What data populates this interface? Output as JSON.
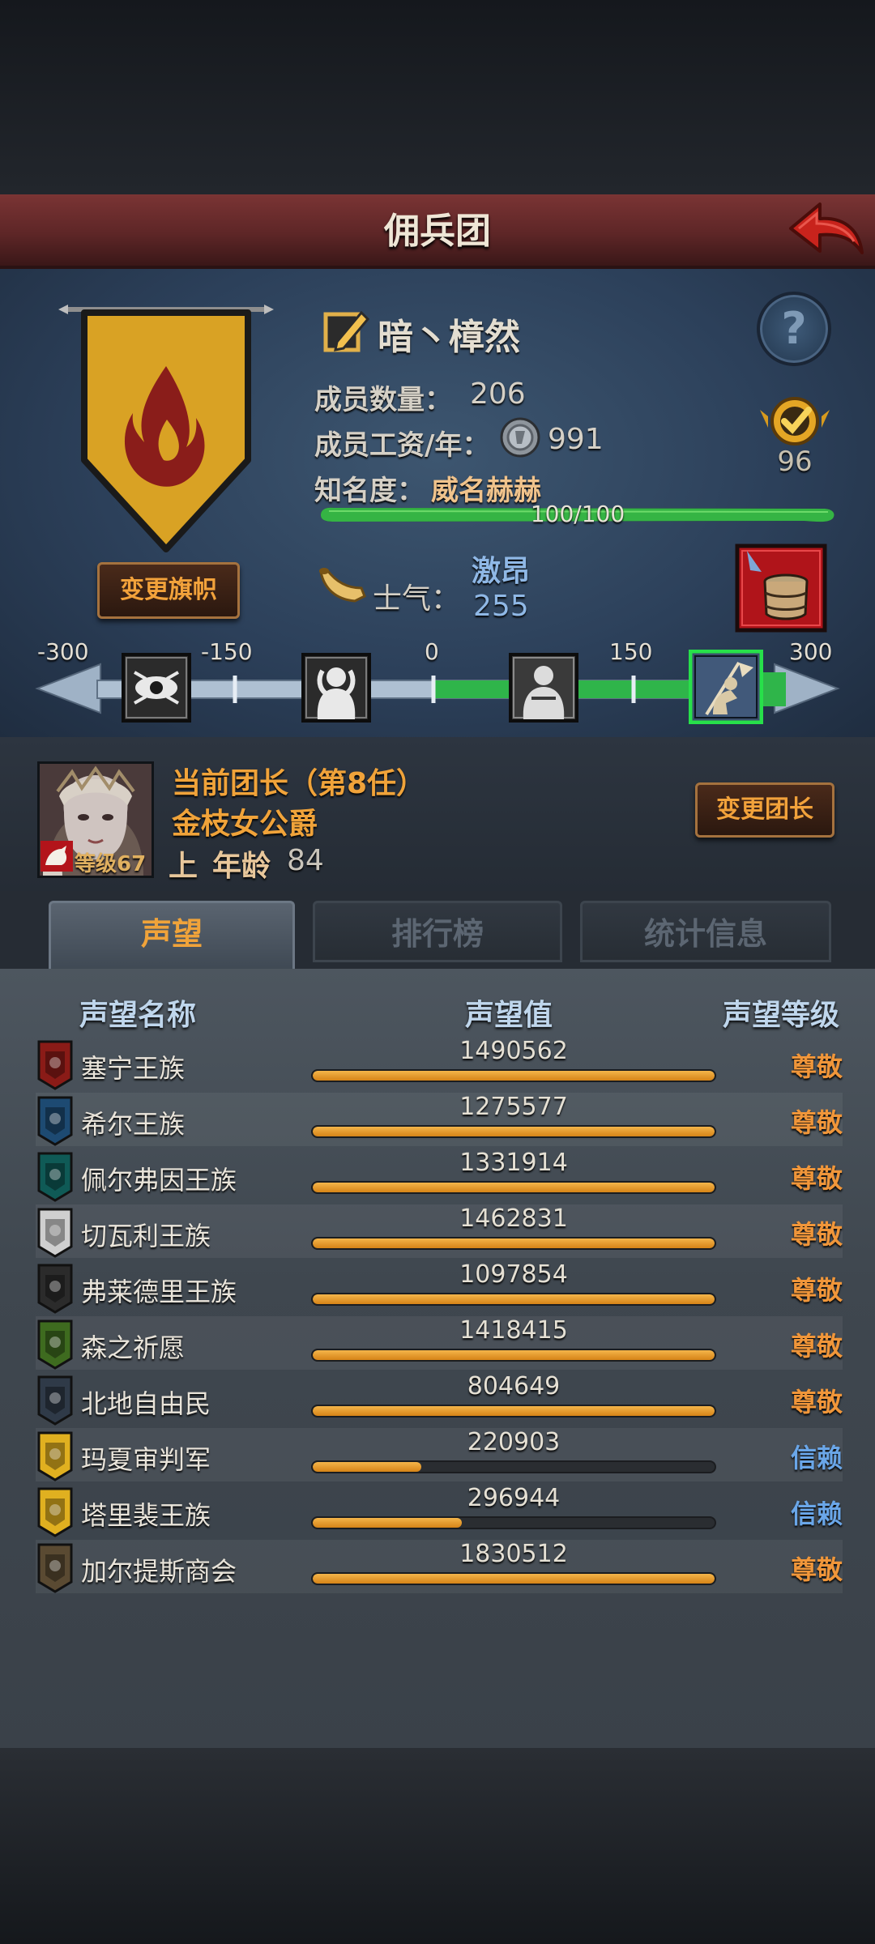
{
  "header": {
    "title": "佣兵团"
  },
  "guild": {
    "name": "暗丶樟然",
    "members_label": "成员数量：",
    "members": "206",
    "wage_label": "成员工资/年：",
    "wage": "991",
    "fame_label": "知名度：",
    "fame_status": "威名赫赫",
    "fame_progress": "100/100",
    "fame_fraction": 1.0,
    "rank": "96",
    "change_flag_label": "变更旗帜"
  },
  "morale": {
    "label": "士气：",
    "status": "激昂",
    "value": "255",
    "ticks": [
      "-300",
      "-150",
      "0",
      "150",
      "300"
    ],
    "numeric_value": 255
  },
  "commander": {
    "title": "当前团长（第8任）",
    "name": "金枝女公爵",
    "level": "等级67",
    "trend": "上",
    "age_label": "年龄",
    "age": "84",
    "change_leader_label": "变更团长"
  },
  "tabs": [
    {
      "label": "声望"
    },
    {
      "label": "排行榜"
    },
    {
      "label": "统计信息"
    }
  ],
  "table": {
    "headers": {
      "name": "声望名称",
      "value": "声望值",
      "level": "声望等级"
    },
    "rows": [
      {
        "name": "塞宁王族",
        "value": "1490562",
        "fill": 1.0,
        "level": "尊敬",
        "level_color": "#f0963a",
        "icon_color": "#8a1b17"
      },
      {
        "name": "希尔王族",
        "value": "1275577",
        "fill": 1.0,
        "level": "尊敬",
        "level_color": "#f0963a",
        "icon_color": "#1d4a72"
      },
      {
        "name": "佩尔弗因王族",
        "value": "1331914",
        "fill": 1.0,
        "level": "尊敬",
        "level_color": "#f0963a",
        "icon_color": "#0f5a56"
      },
      {
        "name": "切瓦利王族",
        "value": "1462831",
        "fill": 1.0,
        "level": "尊敬",
        "level_color": "#f0963a",
        "icon_color": "#cfcfcf"
      },
      {
        "name": "弗莱德里王族",
        "value": "1097854",
        "fill": 1.0,
        "level": "尊敬",
        "level_color": "#f0963a",
        "icon_color": "#2b2b2b"
      },
      {
        "name": "森之祈愿",
        "value": "1418415",
        "fill": 1.0,
        "level": "尊敬",
        "level_color": "#f0963a",
        "icon_color": "#3e6b1f"
      },
      {
        "name": "北地自由民",
        "value": "804649",
        "fill": 1.0,
        "level": "尊敬",
        "level_color": "#f0963a",
        "icon_color": "#2f3a48"
      },
      {
        "name": "玛夏审判军",
        "value": "220903",
        "fill": 0.27,
        "level": "信赖",
        "level_color": "#6aa6e8",
        "icon_color": "#e0b020"
      },
      {
        "name": "塔里裴王族",
        "value": "296944",
        "fill": 0.37,
        "level": "信赖",
        "level_color": "#6aa6e8",
        "icon_color": "#e0b020"
      },
      {
        "name": "加尔提斯商会",
        "value": "1830512",
        "fill": 1.0,
        "level": "尊敬",
        "level_color": "#f0963a",
        "icon_color": "#5a4a32"
      }
    ]
  }
}
